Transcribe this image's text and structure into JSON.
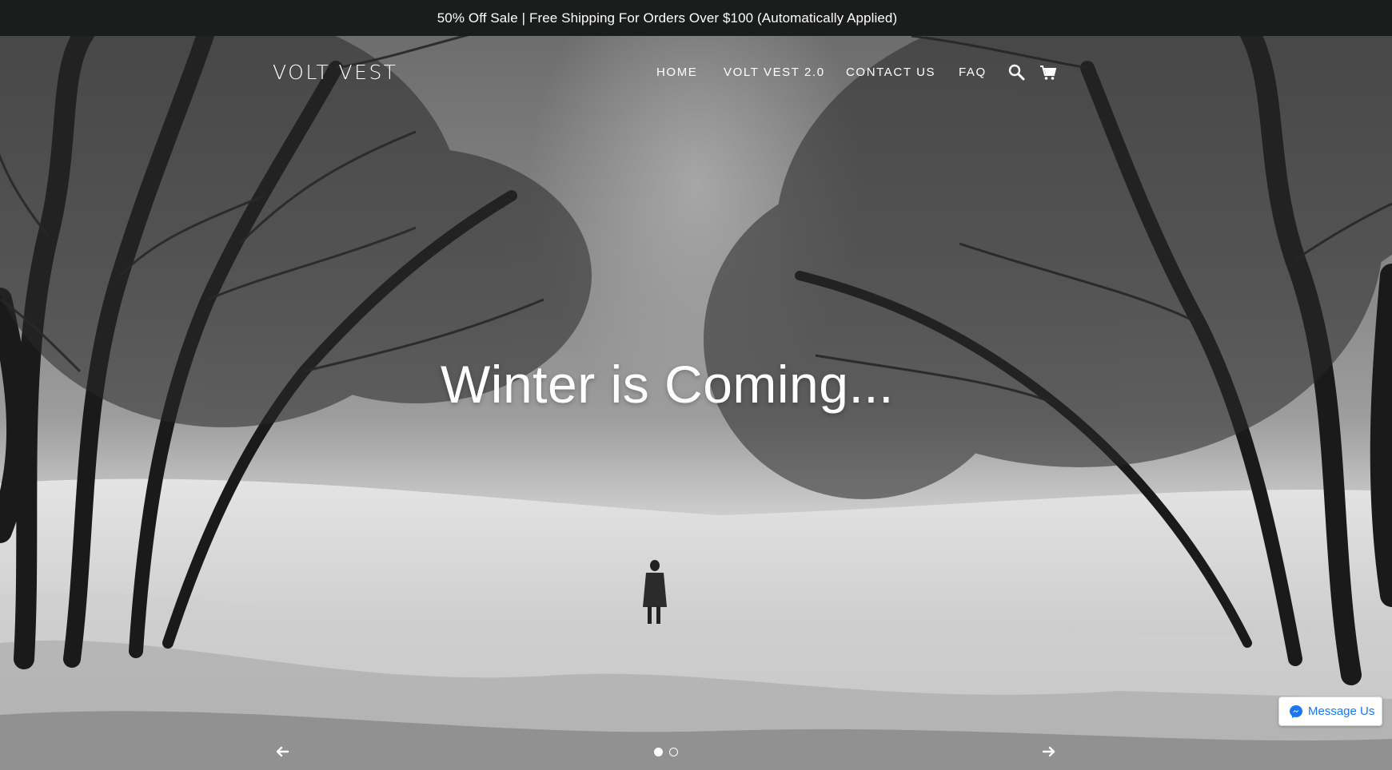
{
  "announcement": {
    "text": "50% Off Sale | Free Shipping For Orders Over $100 (Automatically Applied)"
  },
  "header": {
    "logo": "VOLT VEST",
    "nav": [
      {
        "label": "HOME"
      },
      {
        "label": "VOLT VEST 2.0"
      },
      {
        "label": "CONTACT US"
      },
      {
        "label": "FAQ"
      }
    ],
    "icons": [
      "search-icon",
      "cart-icon"
    ]
  },
  "hero": {
    "title": "Winter is Coming...",
    "slides_total": 2,
    "active_slide": 1
  },
  "messenger": {
    "label": "Message Us",
    "color": "#1877f2"
  },
  "colors": {
    "announcement_bg": "#1b1d1d",
    "text": "#ffffff"
  }
}
